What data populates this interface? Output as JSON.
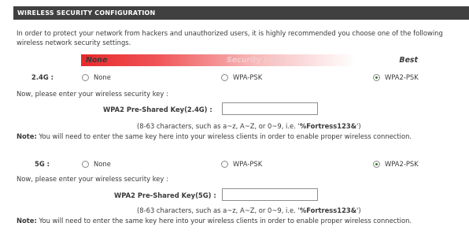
{
  "header": {
    "title": "WIRELESS SECURITY CONFIGURATION"
  },
  "intro": "In order to protect your network from hackers and unauthorized users, it is highly recommended you choose one of the following wireless network security settings.",
  "security_level": {
    "left": "None",
    "title": "Security Level",
    "right": "Best"
  },
  "bands": [
    {
      "label": "2.4G :",
      "options": [
        "None",
        "WPA-PSK",
        "WPA2-PSK"
      ],
      "selected": "WPA2-PSK",
      "prompt": "Now, please enter your wireless security key :",
      "key_label": "WPA2 Pre-Shared Key(2.4G) :",
      "key_value": "",
      "hint_prefix": "(8-63 characters, such as a~z, A~Z, or 0~9, i.e. '",
      "hint_example": "%Fortress123&",
      "hint_suffix": "')",
      "note_label": "Note:",
      "note_text": " You will need to enter the same key here into your wireless clients in order to enable proper wireless connection."
    },
    {
      "label": "5G :",
      "options": [
        "None",
        "WPA-PSK",
        "WPA2-PSK"
      ],
      "selected": "WPA2-PSK",
      "prompt": "Now, please enter your wireless security key :",
      "key_label": "WPA2 Pre-Shared Key(5G) :",
      "key_value": "",
      "hint_prefix": "(8-63 characters, such as a~z, A~Z, or 0~9, i.e. '",
      "hint_example": "%Fortress123&",
      "hint_suffix": "')",
      "note_label": "Note:",
      "note_text": " You will need to enter the same key here into your wireless clients in order to enable proper wireless connection."
    }
  ]
}
